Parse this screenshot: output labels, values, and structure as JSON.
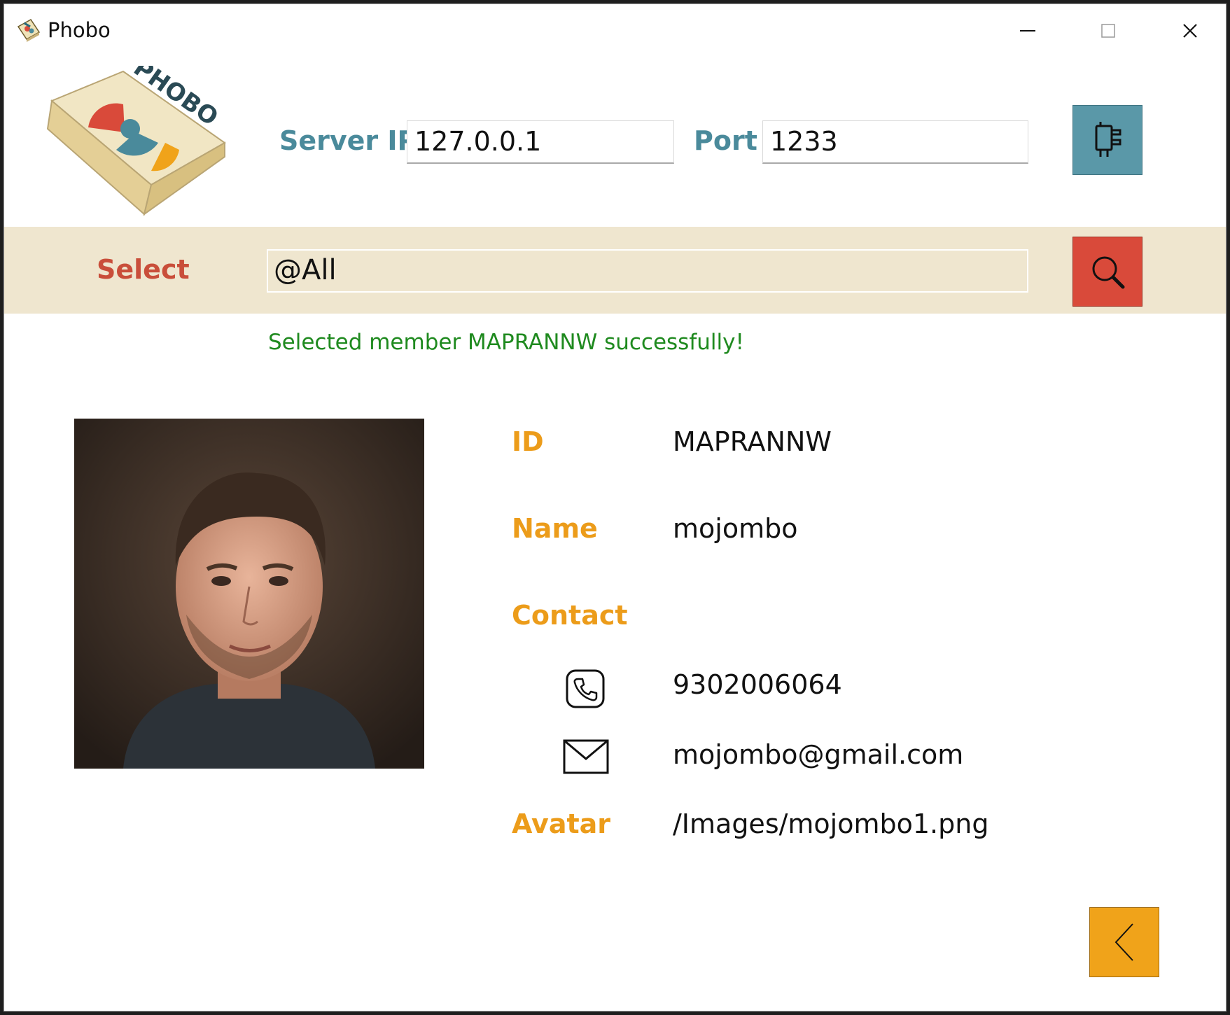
{
  "window": {
    "title": "Phobo",
    "controls": [
      "minimize",
      "maximize",
      "close"
    ]
  },
  "logo": {
    "text": "PHOBO"
  },
  "server": {
    "ip_label": "Server IP",
    "ip_value": "127.0.0.1",
    "port_label": "Port",
    "port_value": "1233",
    "connect_icon": "plug-icon"
  },
  "select": {
    "label": "Select",
    "value": "@All",
    "search_icon": "search-icon"
  },
  "status": {
    "message": "Selected member MAPRANNW successfully!",
    "color": "#1f8a1f"
  },
  "member": {
    "id_label": "ID",
    "id_value": "MAPRANNW",
    "name_label": "Name",
    "name_value": "mojombo",
    "contact_label": "Contact",
    "phone_value": "9302006064",
    "email_value": "mojombo@gmail.com",
    "avatar_label": "Avatar",
    "avatar_value": "/Images/mojombo1.png"
  },
  "colors": {
    "teal": "#5a98a8",
    "red": "#d94a3a",
    "orange": "#f0a31a",
    "band": "#efe6cf"
  },
  "nav": {
    "back_icon": "chevron-left-icon"
  }
}
